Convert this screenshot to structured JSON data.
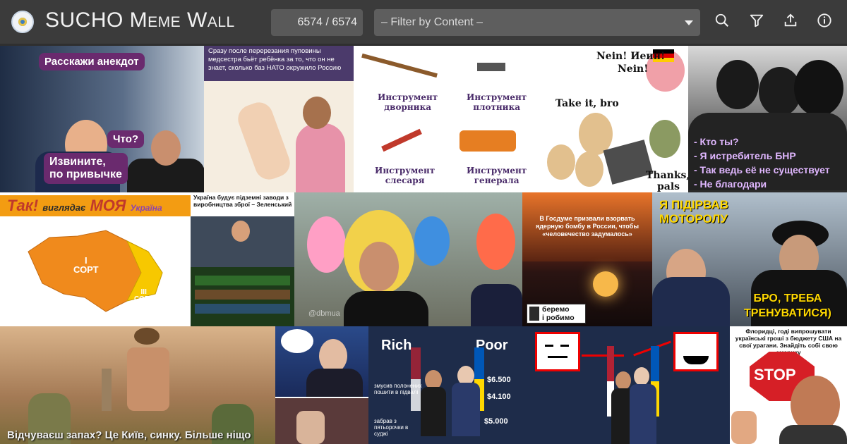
{
  "app": {
    "title": "SUCHO Meme Wall",
    "counter": "6574 / 6574",
    "filter_placeholder": "– Filter by Content –"
  },
  "toolbar": {
    "search_icon": "search-icon",
    "filter_icon": "filter-icon",
    "share_icon": "share-icon",
    "info_icon": "info-icon"
  },
  "memes": {
    "m1": {
      "b1": "Расскажи анекдот",
      "b2": "Что?",
      "b3": "Извините,",
      "b4": "по привычке"
    },
    "m2": {
      "text": "Сразу после перерезания пуповины медсестра бьёт ребёнка за то, что он не знает, сколько баз НАТО окружило Россию"
    },
    "m3": {
      "t1a": "Инструмент",
      "t1b": "дворника",
      "t2a": "Инструмент",
      "t2b": "плотника",
      "t3a": "Инструмент",
      "t3b": "слесаря",
      "t4a": "Инструмент",
      "t4b": "генерала"
    },
    "m4": {
      "nein1": "Nein! Иеин!",
      "nein2": "Nein!",
      "take": "Take it, bro",
      "thanks1": "Thanks,",
      "thanks2": "pals"
    },
    "m5": {
      "l1": "- Кто ты?",
      "l2": "- Я истребитель БНР",
      "l3": "- Так ведь её не существует",
      "l4": "- Не благодари"
    },
    "m6": {
      "t1": "Так!",
      "t2": "виглядає",
      "t3": "МОЯ",
      "t4": "Україна",
      "s1": "I",
      "s1b": "СОРТ",
      "s3": "III",
      "s3b": "СОРТ"
    },
    "m7": {
      "head": "Україна будує підземні заводи з виробництва зброї – Зеленський"
    },
    "m8": {
      "wm": "@dbmua"
    },
    "m9": {
      "head": "В Госдуме призвали взорвать ядерную бомбу в России, чтобы «человечество задумалось»",
      "logo1": "беремо",
      "logo2": "і робимо"
    },
    "m10": {
      "t1": "Я ПІДІРВАВ",
      "t2": "МОТОРОЛУ",
      "t3": "БРО, ТРЕБА",
      "t4": "ТРЕНУВАТИСЯ)"
    },
    "m11": {
      "caption": "Відчуваєш запах? Це Київ, синку. Більше ніщо"
    },
    "m13": {
      "rich": "Rich",
      "poor": "Poor",
      "v1": "$6.500",
      "v2": "$4.100",
      "v3": "$5.000",
      "n1": "змусив полонених пошити в підвалі",
      "n2": "забрав з пятьорочки в суджі"
    },
    "m15": {
      "head": "Флоридці, годі випрошувати українські гроші з бюджету США на свої урагани. Знайдіть собі свою америку",
      "stop": "STOP"
    }
  }
}
